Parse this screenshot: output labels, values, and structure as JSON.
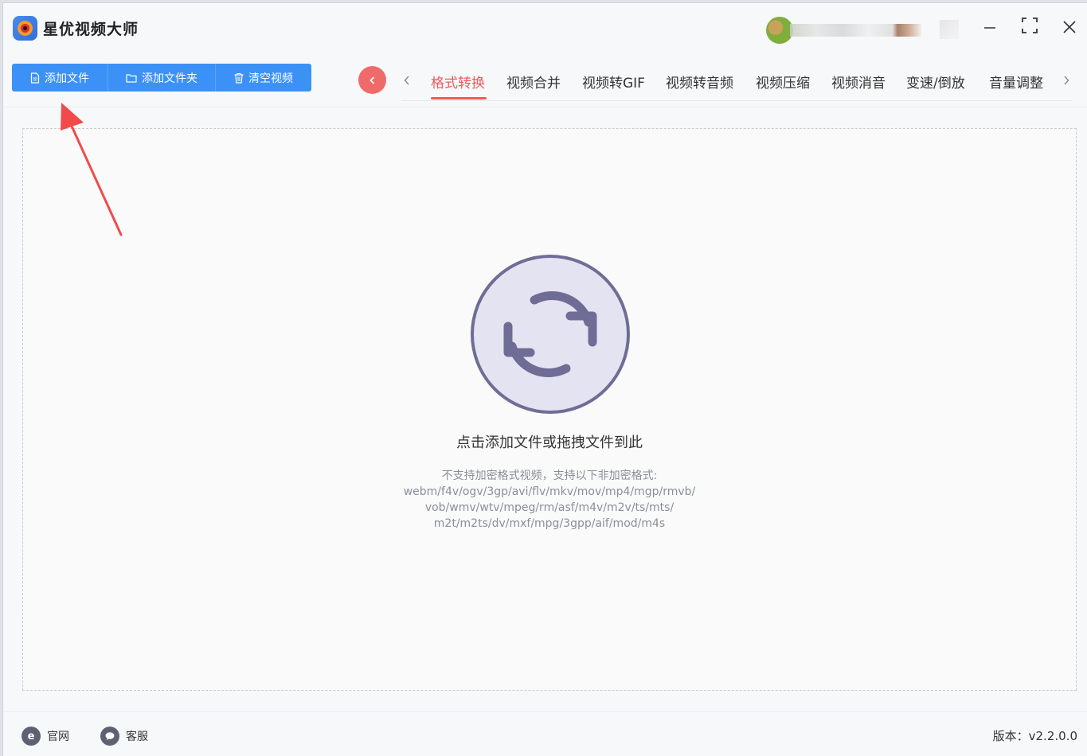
{
  "app": {
    "title": "星优视频大师"
  },
  "toolbar": {
    "add_file": "添加文件",
    "add_folder": "添加文件夹",
    "clear_videos": "清空视频"
  },
  "tabs": [
    {
      "label": "格式转换",
      "active": true
    },
    {
      "label": "视频合并"
    },
    {
      "label": "视频转GIF"
    },
    {
      "label": "视频转音频"
    },
    {
      "label": "视频压缩"
    },
    {
      "label": "视频消音"
    },
    {
      "label": "变速/倒放"
    },
    {
      "label": "音量调整"
    }
  ],
  "dropzone": {
    "main_text": "点击添加文件或拖拽文件到此",
    "notice_line1": "不支持加密格式视频，支持以下非加密格式:",
    "notice_line2": "webm/f4v/ogv/3gp/avi/flv/mkv/mov/mp4/mgp/rmvb/",
    "notice_line3": "vob/wmv/wtv/mpeg/rm/asf/m4v/m2v/ts/mts/",
    "notice_line4": "m2t/m2ts/dv/mxf/mpg/3gpp/aif/mod/m4s"
  },
  "footer": {
    "website": "官网",
    "support": "客服",
    "version": "版本：v2.2.0.0"
  },
  "colors": {
    "primary": "#3c91f6",
    "active_tab": "#ef5a5a",
    "annotation_arrow": "#f24a4a",
    "icon_circle_fill": "#e4e3f1",
    "icon_circle_stroke": "#6f6d96"
  },
  "icons": {
    "add_file": "document-icon",
    "add_folder": "folder-icon",
    "clear": "trash-icon",
    "convert": "refresh-icon",
    "website": "ie-icon",
    "support": "chat-icon"
  }
}
